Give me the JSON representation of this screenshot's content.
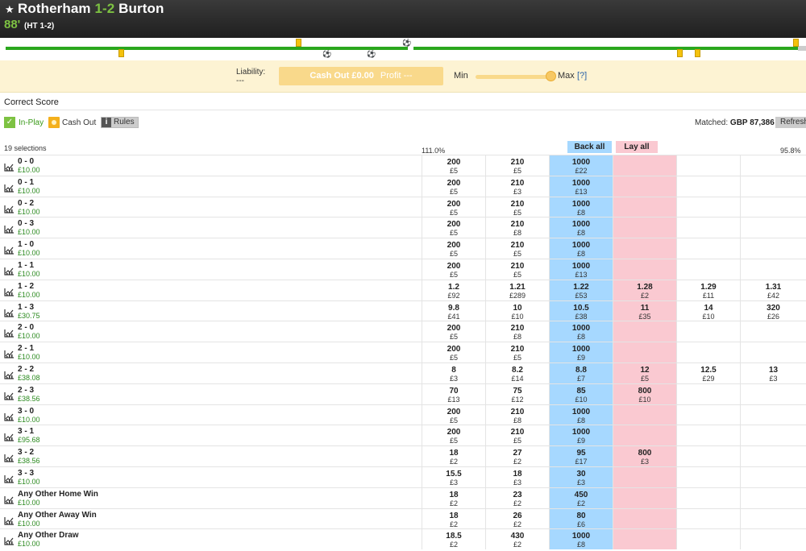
{
  "header": {
    "home": "Rotherham",
    "score": "1-2",
    "away": "Burton",
    "minute": "88'",
    "half_time": "(HT 1-2)"
  },
  "cashout": {
    "liability_label": "Liability:",
    "liability_value": "---",
    "button_label": "Cash Out £0.00",
    "profit_label": "Profit ---",
    "min_label": "Min",
    "max_label": "Max",
    "help": "[?]",
    "slider_level": 1.0
  },
  "market": {
    "title": "Correct Score",
    "inplay": "In-Play",
    "cash_out": "Cash Out",
    "rules": "Rules",
    "matched_label": "Matched:",
    "matched_value": "GBP 87,386",
    "refresh": "Refresh",
    "selections": "19 selections",
    "back_pct": "111.0%",
    "lay_pct": "95.8%",
    "back_all": "Back all",
    "lay_all": "Lay all"
  },
  "runners": [
    {
      "name": "0 - 0",
      "pl": "£10.00",
      "prices": [
        [
          "200",
          "£5"
        ],
        [
          "210",
          "£5"
        ],
        [
          "1000",
          "£22"
        ],
        [
          "",
          ""
        ],
        [
          "",
          ""
        ],
        [
          "",
          ""
        ]
      ]
    },
    {
      "name": "0 - 1",
      "pl": "£10.00",
      "prices": [
        [
          "200",
          "£5"
        ],
        [
          "210",
          "£3"
        ],
        [
          "1000",
          "£13"
        ],
        [
          "",
          ""
        ],
        [
          "",
          ""
        ],
        [
          "",
          ""
        ]
      ]
    },
    {
      "name": "0 - 2",
      "pl": "£10.00",
      "prices": [
        [
          "200",
          "£5"
        ],
        [
          "210",
          "£5"
        ],
        [
          "1000",
          "£8"
        ],
        [
          "",
          ""
        ],
        [
          "",
          ""
        ],
        [
          "",
          ""
        ]
      ]
    },
    {
      "name": "0 - 3",
      "pl": "£10.00",
      "prices": [
        [
          "200",
          "£5"
        ],
        [
          "210",
          "£8"
        ],
        [
          "1000",
          "£8"
        ],
        [
          "",
          ""
        ],
        [
          "",
          ""
        ],
        [
          "",
          ""
        ]
      ]
    },
    {
      "name": "1 - 0",
      "pl": "£10.00",
      "prices": [
        [
          "200",
          "£5"
        ],
        [
          "210",
          "£5"
        ],
        [
          "1000",
          "£8"
        ],
        [
          "",
          ""
        ],
        [
          "",
          ""
        ],
        [
          "",
          ""
        ]
      ]
    },
    {
      "name": "1 - 1",
      "pl": "£10.00",
      "prices": [
        [
          "200",
          "£5"
        ],
        [
          "210",
          "£5"
        ],
        [
          "1000",
          "£13"
        ],
        [
          "",
          ""
        ],
        [
          "",
          ""
        ],
        [
          "",
          ""
        ]
      ]
    },
    {
      "name": "1 - 2",
      "pl": "£10.00",
      "prices": [
        [
          "1.2",
          "£92"
        ],
        [
          "1.21",
          "£289"
        ],
        [
          "1.22",
          "£53"
        ],
        [
          "1.28",
          "£2"
        ],
        [
          "1.29",
          "£11"
        ],
        [
          "1.31",
          "£42"
        ]
      ]
    },
    {
      "name": "1 - 3",
      "pl": "£30.75",
      "prices": [
        [
          "9.8",
          "£41"
        ],
        [
          "10",
          "£10"
        ],
        [
          "10.5",
          "£38"
        ],
        [
          "11",
          "£35"
        ],
        [
          "14",
          "£10"
        ],
        [
          "320",
          "£26"
        ]
      ]
    },
    {
      "name": "2 - 0",
      "pl": "£10.00",
      "prices": [
        [
          "200",
          "£5"
        ],
        [
          "210",
          "£8"
        ],
        [
          "1000",
          "£8"
        ],
        [
          "",
          ""
        ],
        [
          "",
          ""
        ],
        [
          "",
          ""
        ]
      ]
    },
    {
      "name": "2 - 1",
      "pl": "£10.00",
      "prices": [
        [
          "200",
          "£5"
        ],
        [
          "210",
          "£5"
        ],
        [
          "1000",
          "£9"
        ],
        [
          "",
          ""
        ],
        [
          "",
          ""
        ],
        [
          "",
          ""
        ]
      ]
    },
    {
      "name": "2 - 2",
      "pl": "£38.08",
      "prices": [
        [
          "8",
          "£3"
        ],
        [
          "8.2",
          "£14"
        ],
        [
          "8.8",
          "£7"
        ],
        [
          "12",
          "£5"
        ],
        [
          "12.5",
          "£29"
        ],
        [
          "13",
          "£3"
        ]
      ]
    },
    {
      "name": "2 - 3",
      "pl": "£38.56",
      "prices": [
        [
          "70",
          "£13"
        ],
        [
          "75",
          "£12"
        ],
        [
          "85",
          "£10"
        ],
        [
          "800",
          "£10"
        ],
        [
          "",
          ""
        ],
        [
          "",
          ""
        ]
      ]
    },
    {
      "name": "3 - 0",
      "pl": "£10.00",
      "prices": [
        [
          "200",
          "£5"
        ],
        [
          "210",
          "£8"
        ],
        [
          "1000",
          "£8"
        ],
        [
          "",
          ""
        ],
        [
          "",
          ""
        ],
        [
          "",
          ""
        ]
      ]
    },
    {
      "name": "3 - 1",
      "pl": "£95.68",
      "prices": [
        [
          "200",
          "£5"
        ],
        [
          "210",
          "£5"
        ],
        [
          "1000",
          "£9"
        ],
        [
          "",
          ""
        ],
        [
          "",
          ""
        ],
        [
          "",
          ""
        ]
      ]
    },
    {
      "name": "3 - 2",
      "pl": "£38.56",
      "prices": [
        [
          "18",
          "£2"
        ],
        [
          "27",
          "£2"
        ],
        [
          "95",
          "£17"
        ],
        [
          "800",
          "£3"
        ],
        [
          "",
          ""
        ],
        [
          "",
          ""
        ]
      ]
    },
    {
      "name": "3 - 3",
      "pl": "£10.00",
      "prices": [
        [
          "15.5",
          "£3"
        ],
        [
          "18",
          "£3"
        ],
        [
          "30",
          "£3"
        ],
        [
          "",
          ""
        ],
        [
          "",
          ""
        ],
        [
          "",
          ""
        ]
      ]
    },
    {
      "name": "Any Other Home Win",
      "pl": "£10.00",
      "prices": [
        [
          "18",
          "£2"
        ],
        [
          "23",
          "£2"
        ],
        [
          "450",
          "£2"
        ],
        [
          "",
          ""
        ],
        [
          "",
          ""
        ],
        [
          "",
          ""
        ]
      ]
    },
    {
      "name": "Any Other Away Win",
      "pl": "£10.00",
      "prices": [
        [
          "18",
          "£2"
        ],
        [
          "26",
          "£2"
        ],
        [
          "80",
          "£6"
        ],
        [
          "",
          ""
        ],
        [
          "",
          ""
        ],
        [
          "",
          ""
        ]
      ]
    },
    {
      "name": "Any Other Draw",
      "pl": "£10.00",
      "prices": [
        [
          "18.5",
          "£2"
        ],
        [
          "430",
          "£2"
        ],
        [
          "1000",
          "£8"
        ],
        [
          "",
          ""
        ],
        [
          "",
          ""
        ],
        [
          "",
          ""
        ]
      ]
    }
  ]
}
